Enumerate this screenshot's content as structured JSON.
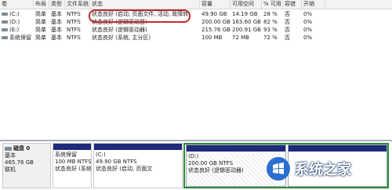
{
  "columns": [
    "卷",
    "布局",
    "类型",
    "文件系统",
    "状态",
    "容量",
    "可用空间",
    "% 可用",
    "容错",
    "开销"
  ],
  "volumes": [
    {
      "name": "(C:)",
      "layout": "简单",
      "type": "基本",
      "fs": "NTFS",
      "status": "状态良好 (启动, 页面文件, 活动, 故障转储, 主分区)",
      "capacity": "49.90 GB",
      "free": "14.19 GB",
      "pct": "28 %",
      "fault": "否",
      "overhead": "0%"
    },
    {
      "name": "(D:)",
      "layout": "简单",
      "type": "基本",
      "fs": "NTFS",
      "status": "状态良好 (逻辑驱动器)",
      "capacity": "200.00 GB",
      "free": "163.60 GB",
      "pct": "82 %",
      "fault": "否",
      "overhead": "0%"
    },
    {
      "name": "(E:)",
      "layout": "简单",
      "type": "基本",
      "fs": "NTFS",
      "status": "状态良好 (逻辑驱动器)",
      "capacity": "215.76 GB",
      "free": "200.91 GB",
      "pct": "93 %",
      "fault": "否",
      "overhead": "0%"
    },
    {
      "name": "系统保留",
      "layout": "简单",
      "type": "基本",
      "fs": "NTFS",
      "status": "状态良好 (系统, 主分区)",
      "capacity": "100 MB",
      "free": "72 MB",
      "pct": "72 %",
      "fault": "否",
      "overhead": "0%"
    }
  ],
  "disk": {
    "title": "磁盘 0",
    "type": "基本",
    "size": "465.76 GB",
    "state": "联机"
  },
  "partitions": [
    {
      "name": "系统保留",
      "size": "100 MB NTFS",
      "status": "状态良好 (系统,"
    },
    {
      "name": "(C:)",
      "size": "49.90 GB NTFS",
      "status": "状态良好 (启动, 页面文"
    },
    {
      "name": "(D:)",
      "size": "200.00 GB NTFS",
      "status": "状态良好 (逻辑驱动器)"
    },
    {
      "name": "",
      "size": "",
      "status": ""
    }
  ],
  "watermark": "系统之家",
  "colors": {
    "partition_bar": "#1f2a7a",
    "selection": "#2f8a3a",
    "annotation": "#c8282d"
  }
}
